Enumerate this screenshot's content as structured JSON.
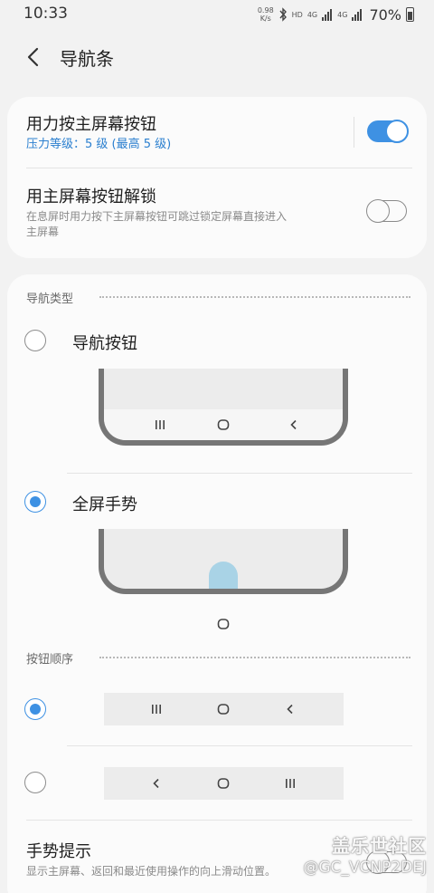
{
  "status_bar": {
    "time": "10:33",
    "net_speed_value": "0.98",
    "net_speed_unit": "K/s",
    "hd_1": "HD",
    "lte_1": "4G",
    "lte_2": "4G",
    "battery": "70%"
  },
  "header": {
    "title": "导航条"
  },
  "top_card": {
    "pressure_title": "用力按主屏幕按钮",
    "pressure_sub": "压力等级：5 级 (最高 5 级)",
    "pressure_on": true,
    "unlock_title": "用主屏幕按钮解锁",
    "unlock_sub_1": "在息屏时用力按下主屏幕按钮可跳过锁定屏幕直接进入",
    "unlock_sub_2": "主屏幕",
    "unlock_on": false
  },
  "nav_type": {
    "section_label": "导航类型",
    "options": [
      {
        "label": "导航按钮",
        "checked": false
      },
      {
        "label": "全屏手势",
        "checked": true
      }
    ],
    "nav_icons": [
      "recents-icon",
      "home-icon",
      "back-icon"
    ]
  },
  "button_order": {
    "section_label": "按钮顺序",
    "options": [
      {
        "checked": true,
        "icons": [
          "recents-icon",
          "home-icon",
          "back-icon"
        ]
      },
      {
        "checked": false,
        "icons": [
          "back-icon",
          "home-icon",
          "recents-icon"
        ]
      }
    ]
  },
  "gesture_hint": {
    "title": "手势提示",
    "sub": "显示主屏幕、返回和最近使用操作的向上滑动位置。"
  },
  "watermark": {
    "line1": "盖乐世社区",
    "line2": "@GC_VCNP2DEJ"
  },
  "colors": {
    "accent": "#3e91e3",
    "subtitle_blue": "#2a7fcf",
    "gesture_pill": "#a9d3e6",
    "background": "#f2f2f2",
    "card": "#fbfbfb"
  }
}
